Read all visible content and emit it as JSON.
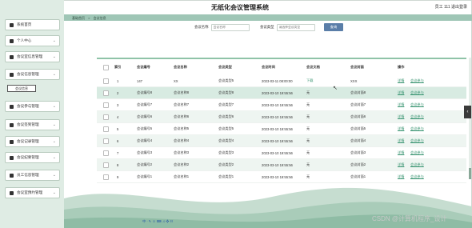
{
  "app": {
    "title": "无纸化会议管理系统"
  },
  "user": {
    "text": "员工 111  退出登录"
  },
  "breadcrumb": {
    "items": [
      "基础首页",
      "会议信息"
    ],
    "sep": ">"
  },
  "sidebar": {
    "items": [
      {
        "label": "系统首页",
        "icon": "home-icon",
        "chevron": ""
      },
      {
        "label": "个人中心",
        "icon": "person-icon",
        "chevron": "⌄"
      },
      {
        "label": "会议室信息管理",
        "icon": "room-icon",
        "chevron": "⌄"
      },
      {
        "label": "会议信息管理",
        "icon": "list-icon",
        "chevron": "⌄"
      },
      {
        "label": "会议信息",
        "icon": "",
        "chevron": ""
      },
      {
        "label": "会议参与管理",
        "icon": "join-icon",
        "chevron": "⌄"
      },
      {
        "label": "会议签到管理",
        "icon": "check-icon",
        "chevron": "⌄"
      },
      {
        "label": "会议记录管理",
        "icon": "record-icon",
        "chevron": "⌄"
      },
      {
        "label": "会议纪要管理",
        "icon": "minutes-icon",
        "chevron": "⌄"
      },
      {
        "label": "员工信息管理",
        "icon": "staff-icon",
        "chevron": "⌄"
      },
      {
        "label": "会议室预约管理",
        "icon": "shield-icon",
        "chevron": "⌄"
      }
    ]
  },
  "search": {
    "name_label": "会议名称",
    "name_placeholder": "会议名称",
    "type_label": "会议类型",
    "type_placeholder": "请选择会议类型",
    "button": "查询"
  },
  "table": {
    "headers": [
      "索引",
      "会议编号",
      "会议名称",
      "会议类型",
      "会议时间",
      "会议文档",
      "会议封面",
      "操作"
    ],
    "rows": [
      {
        "idx": "1",
        "code": "147",
        "name": "XX",
        "type": "会议类型5",
        "time": "2023-03-11 08:00:00",
        "doc": "下载",
        "cover": "XXX",
        "op1": "详情",
        "op2": "会议参与"
      },
      {
        "idx": "2",
        "code": "会议编号8",
        "name": "会议名称8",
        "type": "会议类型8",
        "time": "2023-03-10 19:55:56",
        "doc": "无",
        "cover": "会议封面8",
        "op1": "详情",
        "op2": "会议参与"
      },
      {
        "idx": "3",
        "code": "会议编号7",
        "name": "会议名称7",
        "type": "会议类型7",
        "time": "2023-03-10 19:55:56",
        "doc": "无",
        "cover": "会议封面7",
        "op1": "详情",
        "op2": "会议参与"
      },
      {
        "idx": "4",
        "code": "会议编号6",
        "name": "会议名称6",
        "type": "会议类型6",
        "time": "2023-03-10 19:55:56",
        "doc": "无",
        "cover": "会议封面6",
        "op1": "详情",
        "op2": "会议参与"
      },
      {
        "idx": "5",
        "code": "会议编号5",
        "name": "会议名称5",
        "type": "会议类型5",
        "time": "2023-03-10 19:55:56",
        "doc": "无",
        "cover": "会议封面5",
        "op1": "详情",
        "op2": "会议参与"
      },
      {
        "idx": "6",
        "code": "会议编号4",
        "name": "会议名称4",
        "type": "会议类型4",
        "time": "2023-03-10 19:55:56",
        "doc": "无",
        "cover": "会议封面4",
        "op1": "详情",
        "op2": "会议参与"
      },
      {
        "idx": "7",
        "code": "会议编号3",
        "name": "会议名称3",
        "type": "会议类型3",
        "time": "2023-03-10 19:55:56",
        "doc": "无",
        "cover": "会议封面3",
        "op1": "详情",
        "op2": "会议参与"
      },
      {
        "idx": "8",
        "code": "会议编号2",
        "name": "会议名称2",
        "type": "会议类型2",
        "time": "2023-03-10 19:55:56",
        "doc": "无",
        "cover": "会议封面2",
        "op1": "详情",
        "op2": "会议参与"
      },
      {
        "idx": "9",
        "code": "会议编号1",
        "name": "会议名称1",
        "type": "会议类型1",
        "time": "2023-03-10 19:55:56",
        "doc": "无",
        "cover": "会议封面1",
        "op1": "详情",
        "op2": "会议参与"
      }
    ]
  },
  "watermark": "CSDN @计算机程序_设计",
  "toolbar": {
    "text": "中 ∙ ✎ ☺ ⌨ ♫ ❖ ☷"
  },
  "colors": {
    "accent": "#2f8f6a",
    "sidebar_bg": "#dfece4",
    "button": "#5a7ea8"
  }
}
